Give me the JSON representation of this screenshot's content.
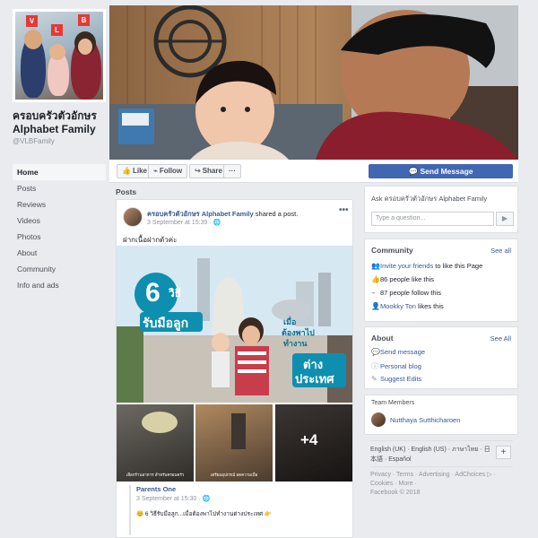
{
  "page": {
    "name_th": "ครอบครัวตัวอักษร",
    "name_en": "Alphabet Family",
    "handle": "@VLBFamily",
    "profile_signs": [
      "V",
      "L",
      "B"
    ]
  },
  "nav": {
    "items": [
      "Home",
      "Posts",
      "Reviews",
      "Videos",
      "Photos",
      "About",
      "Community",
      "Info and ads"
    ],
    "active": 0
  },
  "actions": {
    "like": "Like",
    "follow": "Follow",
    "share": "Share",
    "more": "···",
    "send_message": "Send Message"
  },
  "posts": {
    "heading": "Posts",
    "post": {
      "author": "ครอบครัวตัวอักษร Alphabet Family",
      "shared_text": "shared a post.",
      "timestamp": "3 September at 15:39 · 🌐",
      "menu": "•••",
      "text": "ฝากเนื้อฝากตัวค่ะ",
      "image_text": {
        "number": "6",
        "unit": "วิธี",
        "line2": "รับมือลูก",
        "when1": "เมื่อ",
        "when2": "ต้องพาไป",
        "when3": "ทำงาน",
        "abroad1": "ต่าง",
        "abroad2": "ประเทศ"
      },
      "thumbs": [
        {
          "caption": "เลือกร้านอาหาร สำหรับครอบครัว"
        },
        {
          "caption": "เตรียมอุปกรณ์ ลดความเบื่อ"
        },
        {
          "caption": "",
          "more": "+4"
        }
      ],
      "comment": {
        "author": "Parents One",
        "timestamp": "3 September at 15:30 · 🌐",
        "text": "😊 6 วิธีรับมือลูก...เมื่อต้องพาไปทำงานต่างประเทศ 👉"
      }
    }
  },
  "ask": {
    "title": "Ask ครอบครัวตัวอักษร Alphabet Family",
    "placeholder": "Type a question...",
    "send_icon": "▶"
  },
  "community": {
    "title": "Community",
    "see_all": "See all",
    "invite_link": "Invite your friends",
    "invite_rest": "to like this Page",
    "likes": "86 people like this",
    "follows": "87 people follow this",
    "liker_name": "Mookky Ton",
    "liker_rest": "likes this"
  },
  "about": {
    "title": "About",
    "see_all": "See All",
    "items": [
      "Send message",
      "Personal blog",
      "Suggest Edits"
    ]
  },
  "team": {
    "title": "Team Members",
    "member": "Nutthaya Sutthicharoen"
  },
  "footer": {
    "languages": "English (UK) · English (US) · ภาษาไทย · 日本語 · Español",
    "plus": "+",
    "links": "Privacy · Terms · Advertising · AdChoices ▷ · Cookies · More ·",
    "copyright": "Facebook © 2018"
  },
  "colors": {
    "brand": "#4267b2",
    "link": "#385898",
    "background": "#e9ebee"
  }
}
